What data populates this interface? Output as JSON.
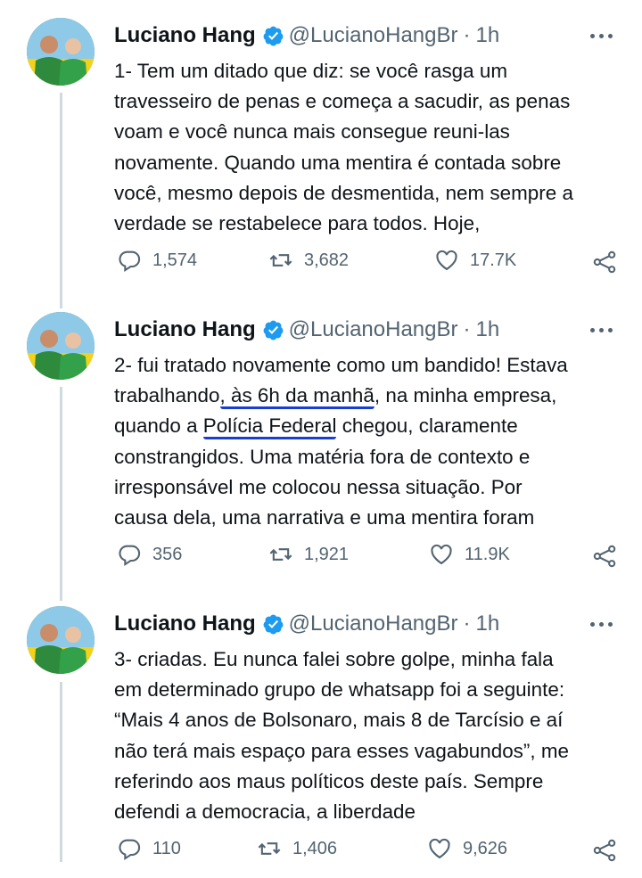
{
  "tweets": [
    {
      "name": "Luciano Hang",
      "handle": "@LucianoHangBr",
      "separator": "·",
      "time": "1h",
      "lines": [
        "1- Tem um ditado que diz: se você rasga um",
        "travesseiro de penas e começa a sacudir, as penas",
        "voam e você nunca mais consegue reuni-las",
        "novamente. Quando uma mentira é contada sobre",
        "você, mesmo depois de desmentida, nem sempre a",
        "verdade se restabelece para todos. Hoje,"
      ],
      "replies": "1,574",
      "retweets": "3,682",
      "likes": "17.7K"
    },
    {
      "name": "Luciano Hang",
      "handle": "@LucianoHangBr",
      "separator": "·",
      "time": "1h",
      "line1": "2- fui tratado novamente como um bandido! Estava",
      "line2_a": "trabalhando",
      "line2_u": ", às 6h da manhã",
      "line2_b": ", na minha empresa,",
      "line3_a": "quando a ",
      "line3_u": "Polícia Federal",
      "line3_b": " chegou, claramente",
      "lines_rest": [
        "constrangidos. Uma matéria fora de contexto e",
        "irresponsável me colocou nessa situação. Por",
        "causa dela, uma narrativa e uma mentira foram"
      ],
      "replies": "356",
      "retweets": "1,921",
      "likes": "11.9K"
    },
    {
      "name": "Luciano Hang",
      "handle": "@LucianoHangBr",
      "separator": "·",
      "time": "1h",
      "lines": [
        "3- criadas. Eu nunca falei sobre golpe, minha fala",
        "em determinado grupo de whatsapp foi a seguinte:",
        "“Mais 4 anos de Bolsonaro, mais 8 de Tarcísio e aí",
        "não terá mais espaço para esses vagabundos”, me",
        "referindo aos maus políticos deste país. Sempre",
        "defendi a democracia, a liberdade"
      ],
      "replies": "110",
      "retweets": "1,406",
      "likes": "9,626"
    }
  ],
  "icons": {
    "verified": "verified-badge-icon",
    "more": "more-options-icon",
    "reply": "reply-icon",
    "retweet": "retweet-icon",
    "like": "like-icon",
    "share": "share-icon"
  },
  "colors": {
    "verified": "#1d9bf0",
    "underline": "#1a3fd0",
    "secondary_text": "#536471",
    "avatar_green": "#2e8b3e",
    "avatar_yellow": "#f3d21a"
  }
}
